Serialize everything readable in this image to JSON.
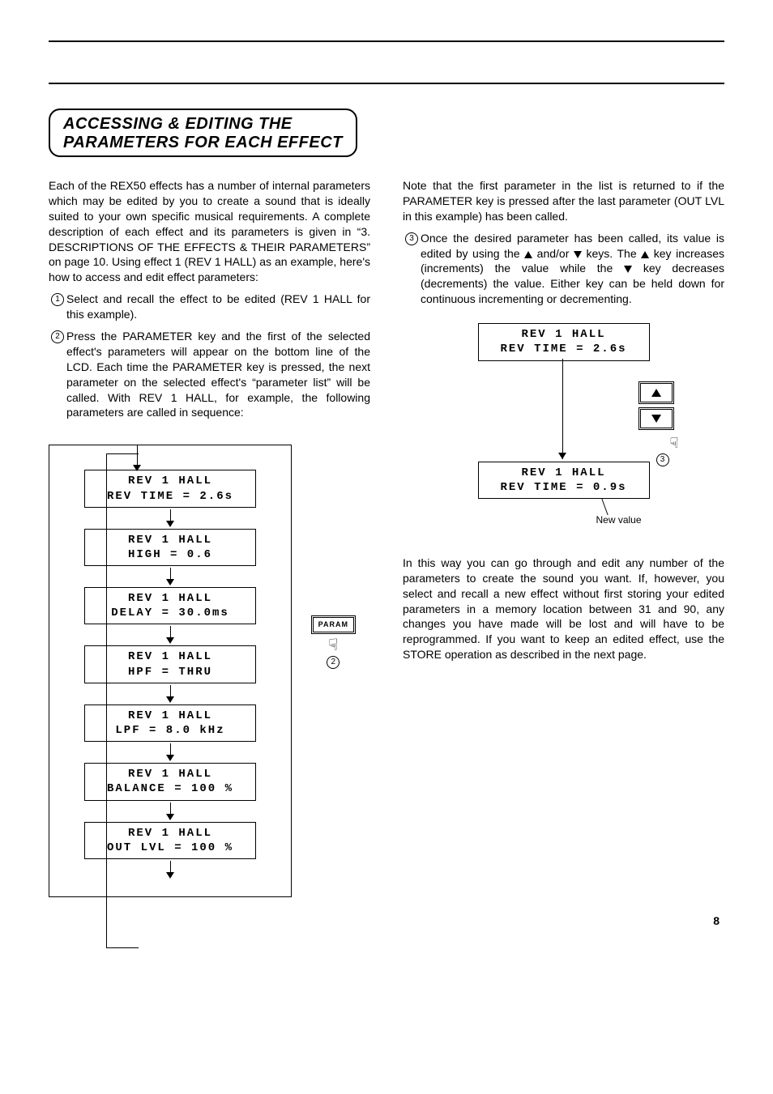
{
  "title_line1": "ACCESSING & EDITING THE",
  "title_line2": "PARAMETERS FOR EACH EFFECT",
  "intro": "Each of the REX50 effects has a number of internal parameters which may be edited by you to create a sound that is ideally suited to your own specific musical requirements. A complete description of each effect and its parameters is given in “3. DESCRIPTIONS OF THE EFFECTS & THEIR PARAMETERS” on page 10. Using effect 1 (REV 1 HALL) as an example, here's how to access and edit effect parameters:",
  "step1": "Select and recall the effect to be edited (REV 1 HALL for this example).",
  "step2": "Press the PARAMETER key and the first of the selected effect's parameters will appear on the bottom line of the LCD. Each time the PARAMETER key is pressed, the next parameter on the selected effect's “parameter list” will be called. With REV 1 HALL, for example, the following parameters are called in sequence:",
  "note_right": "Note that the first parameter in the list is returned to if the PARAMETER key is pressed after the last parameter (OUT LVL in this example) has been called.",
  "step3_a": "Once the desired parameter has been called, its value is edited by using the ",
  "step3_b": " and/or ",
  "step3_c": " keys. The ",
  "step3_d": " key increases (increments) the value while the ",
  "step3_e": " key decreases (decrements) the value. Either key can be held down for continuous incrementing or decrementing.",
  "closing": "In this way you can go through and edit any number of the parameters to create the sound you want. If, however, you select and recall a new effect without first storing your edited parameters in a memory location between 31 and 90, any changes you have made will be lost and will have to be reprogrammed. If you want to keep an edited effect, use the STORE operation as described in the next page.",
  "lcd_title": "REV 1 HALL",
  "seq": [
    "REV TIME = 2.6s",
    "HIGH = 0.6",
    "DELAY = 30.0ms",
    "HPF = THRU",
    "LPF = 8.0 kHz",
    "BALANCE = 100 %",
    "OUT LVL = 100 %"
  ],
  "param_label": "PARAM",
  "step2_ref": "2",
  "step3_ref": "3",
  "edit_before_l1": "REV 1 HALL",
  "edit_before_l2": "REV TIME = 2.6s",
  "edit_after_l1": "REV 1 HALL",
  "edit_after_l2": "REV TIME = 0.9s",
  "new_value_label": "New value",
  "page_number": "8"
}
